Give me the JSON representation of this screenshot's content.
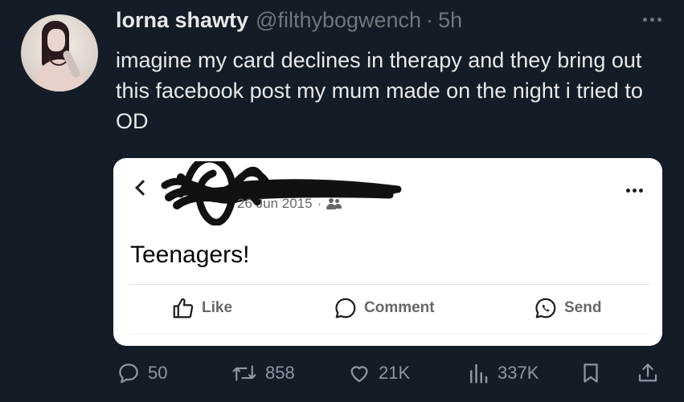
{
  "tweet": {
    "display_name": "lorna shawty",
    "handle": "@filthybogwench",
    "separator": "·",
    "time": "5h",
    "text": "imagine my card declines in therapy and they bring out this facebook post my mum made on the night i tried to OD"
  },
  "embedded_post": {
    "date": "26 Jun 2015",
    "separator": "·",
    "body": "Teenagers!",
    "actions": {
      "like": "Like",
      "comment": "Comment",
      "send": "Send"
    }
  },
  "stats": {
    "replies": "50",
    "retweets": "858",
    "likes": "21K",
    "views": "337K"
  },
  "colors": {
    "background": "#141c27",
    "text": "#e7e9ea",
    "muted": "#71767b",
    "card_bg": "#ffffff",
    "fb_muted": "#65676b"
  },
  "icons": [
    "more-icon",
    "back-chevron-icon",
    "friends-icon",
    "options-icon",
    "like-thumb-icon",
    "comment-bubble-icon",
    "messenger-icon",
    "reply-icon",
    "retweet-icon",
    "heart-icon",
    "views-icon",
    "bookmark-icon",
    "share-icon"
  ]
}
